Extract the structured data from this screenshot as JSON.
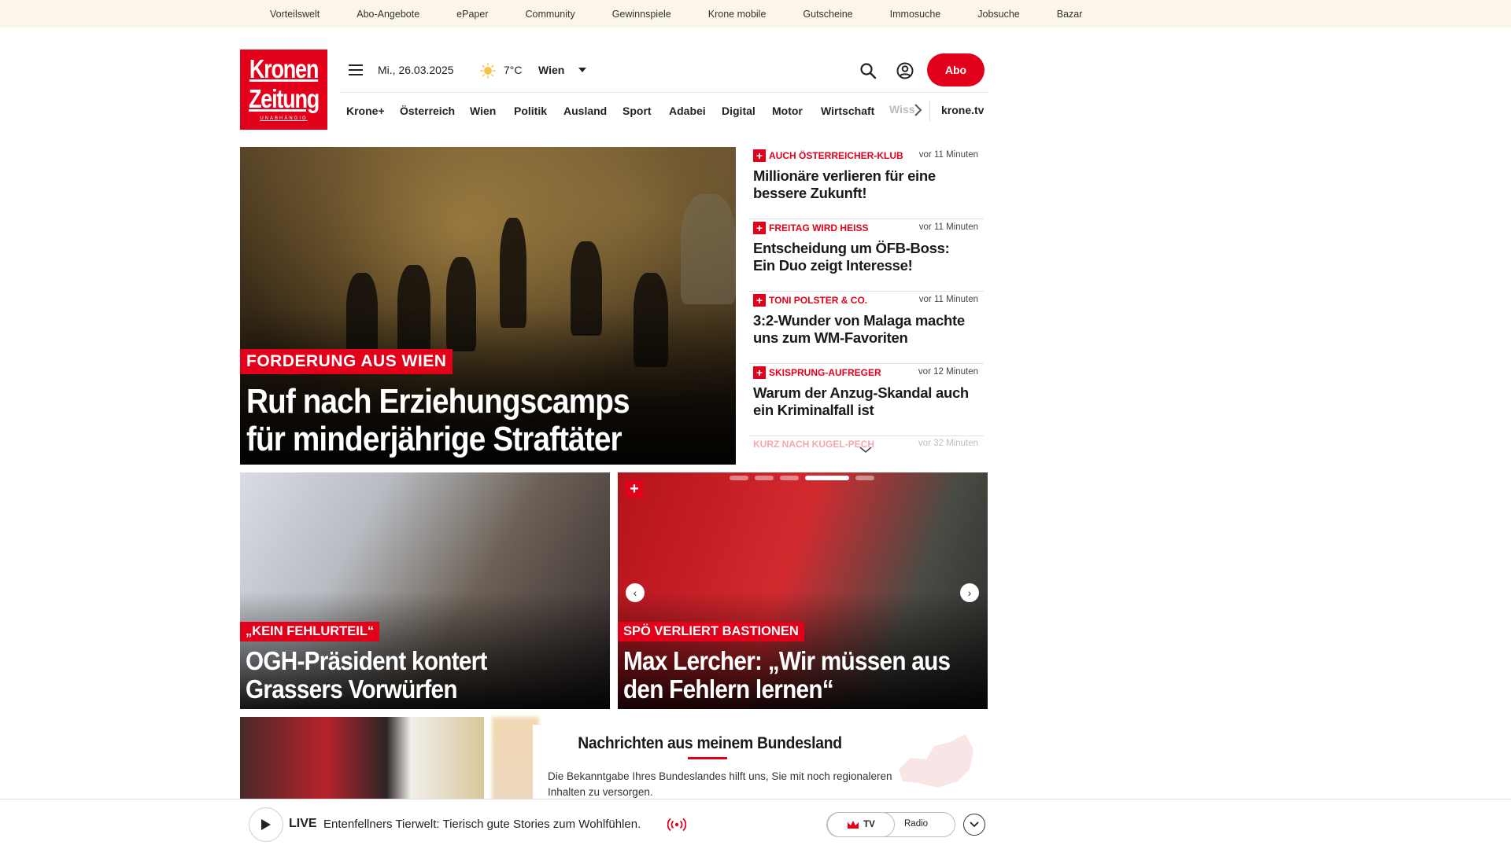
{
  "topnav": [
    "Vorteilswelt",
    "Abo-Angebote",
    "ePaper",
    "Community",
    "Gewinnspiele",
    "Krone mobile",
    "Gutscheine",
    "Immosuche",
    "Jobsuche",
    "Bazar"
  ],
  "logo": {
    "line1": "Kronen",
    "line2": "Zeitung",
    "tagline": "UNABHÄNGIG"
  },
  "header": {
    "date": "Mi., 26.03.2025",
    "temperature": "7°C",
    "city": "Wien",
    "abo_label": "Abo"
  },
  "mainnav": [
    "Krone+",
    "Österreich",
    "Wien",
    "Politik",
    "Ausland",
    "Sport",
    "Adabei",
    "Digital",
    "Motor",
    "Wirtschaft"
  ],
  "mainnav_partial": "Wiss",
  "mainnav_tv": "krone.tv",
  "hero": {
    "kicker": "FORDERUNG AUS WIEN",
    "title": "Ruf nach Erziehungscamps für minderjährige Straftäter"
  },
  "sidelist": [
    {
      "kicker": "AUCH ÖSTERREICHER-KLUB",
      "time": "vor 11 Minuten",
      "title": "Millionäre verlieren für eine bessere Zukunft!"
    },
    {
      "kicker": "FREITAG WIRD HEISS",
      "time": "vor 11 Minuten",
      "title": "Entscheidung um ÖFB-Boss: Ein Duo zeigt Interesse!"
    },
    {
      "kicker": "TONI POLSTER & CO.",
      "time": "vor 11 Minuten",
      "title": "3:2-Wunder von Malaga machte uns zum WM-Favoriten"
    },
    {
      "kicker": "SKISPRUNG-AUFREGER",
      "time": "vor 12 Minuten",
      "title": "Warum der Anzug-Skandal auch ein Kriminalfall ist"
    }
  ],
  "sidelist_partial": {
    "kicker": "KURZ NACH KUGEL-PECH",
    "time": "vor 32 Minuten"
  },
  "cards": [
    {
      "kicker": "„KEIN FEHLURTEIL“",
      "title": "OGH-Präsident kontert Grassers Vorwürfen"
    },
    {
      "kicker": "SPÖ VERLIERT BASTIONEN",
      "title": "Max Lercher: „Wir müssen aus den Fehlern lernen“"
    }
  ],
  "carousel": {
    "slide_count": 5,
    "active_index": 3
  },
  "bundesland": {
    "title": "Nachrichten aus meinem Bundesland",
    "text": "Die Bekanntgabe Ihres Bundeslandes hilft uns, Sie mit noch regionaleren Inhalten zu versorgen."
  },
  "player": {
    "live_label": "LIVE",
    "now_playing": "Entenfellners Tierwelt: Tierisch gute Stories zum Wohlfühlen.",
    "tv_label": "TV",
    "radio_label": "Radio"
  },
  "colors": {
    "brand_red": "#e2001a",
    "topbar_bg": "#fbf6e9"
  }
}
